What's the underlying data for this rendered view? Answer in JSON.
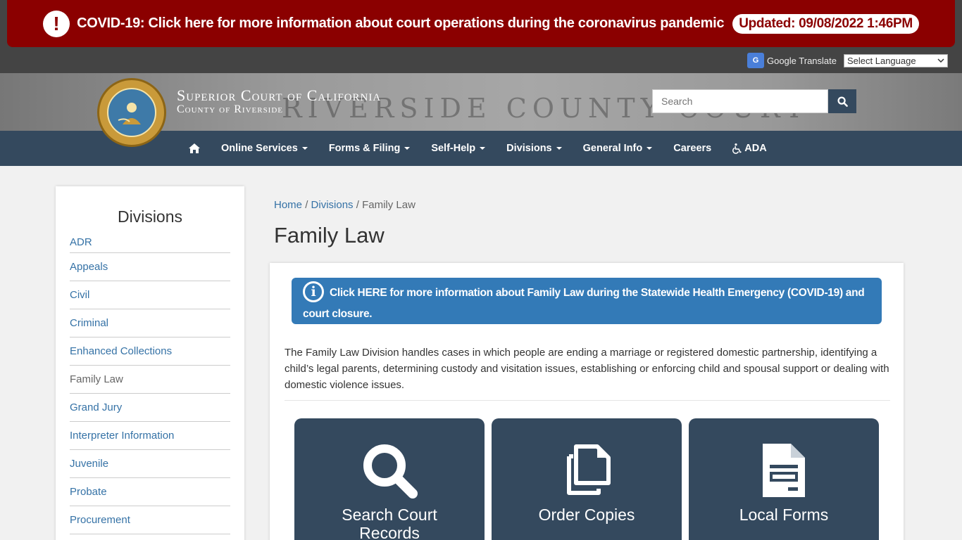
{
  "alert": {
    "icon": "exclamation-circle-icon",
    "text": "COVID-19: Click here for more information about court operations during the coronavirus pandemic",
    "updated": "Updated: 09/08/2022 1:46PM",
    "color": "#8b0000"
  },
  "translate": {
    "label": "Google Translate",
    "select_value": "Select Language"
  },
  "header": {
    "line1": "Superior Court of California",
    "line2": "County of Riverside",
    "engraving": "RIVERSIDE COUNTY COURT",
    "search_placeholder": "Search"
  },
  "nav": {
    "items": [
      {
        "label": "Online Services"
      },
      {
        "label": "Forms & Filing"
      },
      {
        "label": "Self-Help"
      },
      {
        "label": "Divisions"
      },
      {
        "label": "General Info"
      },
      {
        "label": "Careers"
      },
      {
        "label": "ADA"
      }
    ],
    "color": "#34495e"
  },
  "sidebar": {
    "title": "Divisions",
    "items": [
      {
        "label": "ADR"
      },
      {
        "label": "Appeals"
      },
      {
        "label": "Civil"
      },
      {
        "label": "Criminal"
      },
      {
        "label": "Enhanced Collections"
      },
      {
        "label": "Family Law"
      },
      {
        "label": "Grand Jury"
      },
      {
        "label": "Interpreter Information"
      },
      {
        "label": "Juvenile"
      },
      {
        "label": "Probate"
      },
      {
        "label": "Procurement"
      }
    ]
  },
  "breadcrumb": {
    "home": "Home",
    "divisions": "Divisions",
    "current": "Family Law"
  },
  "page": {
    "title": "Family Law",
    "info_text": "Click HERE for more information about Family Law during the Statewide Health Emergency (COVID-19) and court closure.",
    "description": "The Family Law Division handles cases in which people are ending a marriage or registered domestic partnership, identifying a child’s legal parents, determining custody and visitation issues, establishing or enforcing child and spousal support or dealing with domestic violence issues."
  },
  "tiles": [
    {
      "label": "Search Court Records",
      "icon": "search-icon"
    },
    {
      "label": "Order Copies",
      "icon": "copy-icon"
    },
    {
      "label": "Local Forms",
      "icon": "document-icon"
    }
  ],
  "colors": {
    "accent": "#337ab7",
    "link": "#3572a6",
    "tile": "#34495e"
  }
}
